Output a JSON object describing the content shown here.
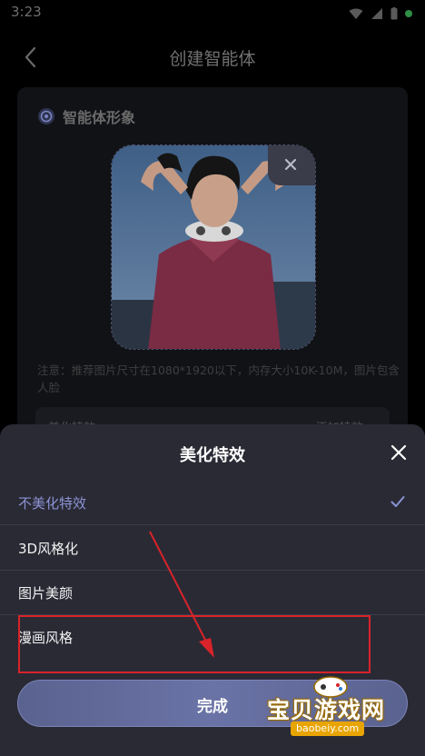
{
  "status_bar": {
    "time": "3:23"
  },
  "header": {
    "title": "创建智能体"
  },
  "card": {
    "title": "智能体形象",
    "note": "注意：推荐图片尺寸在1080*1920以下，内存大小10K-10M，图片包含人脸",
    "row_label": "美化特效",
    "row_value": "添加特效 ›"
  },
  "sheet": {
    "title": "美化特效",
    "options": [
      {
        "label": "不美化特效",
        "selected": true
      },
      {
        "label": "3D风格化",
        "selected": false
      },
      {
        "label": "图片美颜",
        "selected": false
      },
      {
        "label": "漫画风格",
        "selected": false
      }
    ],
    "done_label": "完成"
  },
  "watermark": {
    "text": "宝贝游戏网",
    "url": "baobeiy.com"
  },
  "colors": {
    "sheet_bg": "#2a2a35",
    "selected_text": "#8c93d4",
    "annotation_red": "#d8232a",
    "button_gradient": "#6a73a6"
  }
}
